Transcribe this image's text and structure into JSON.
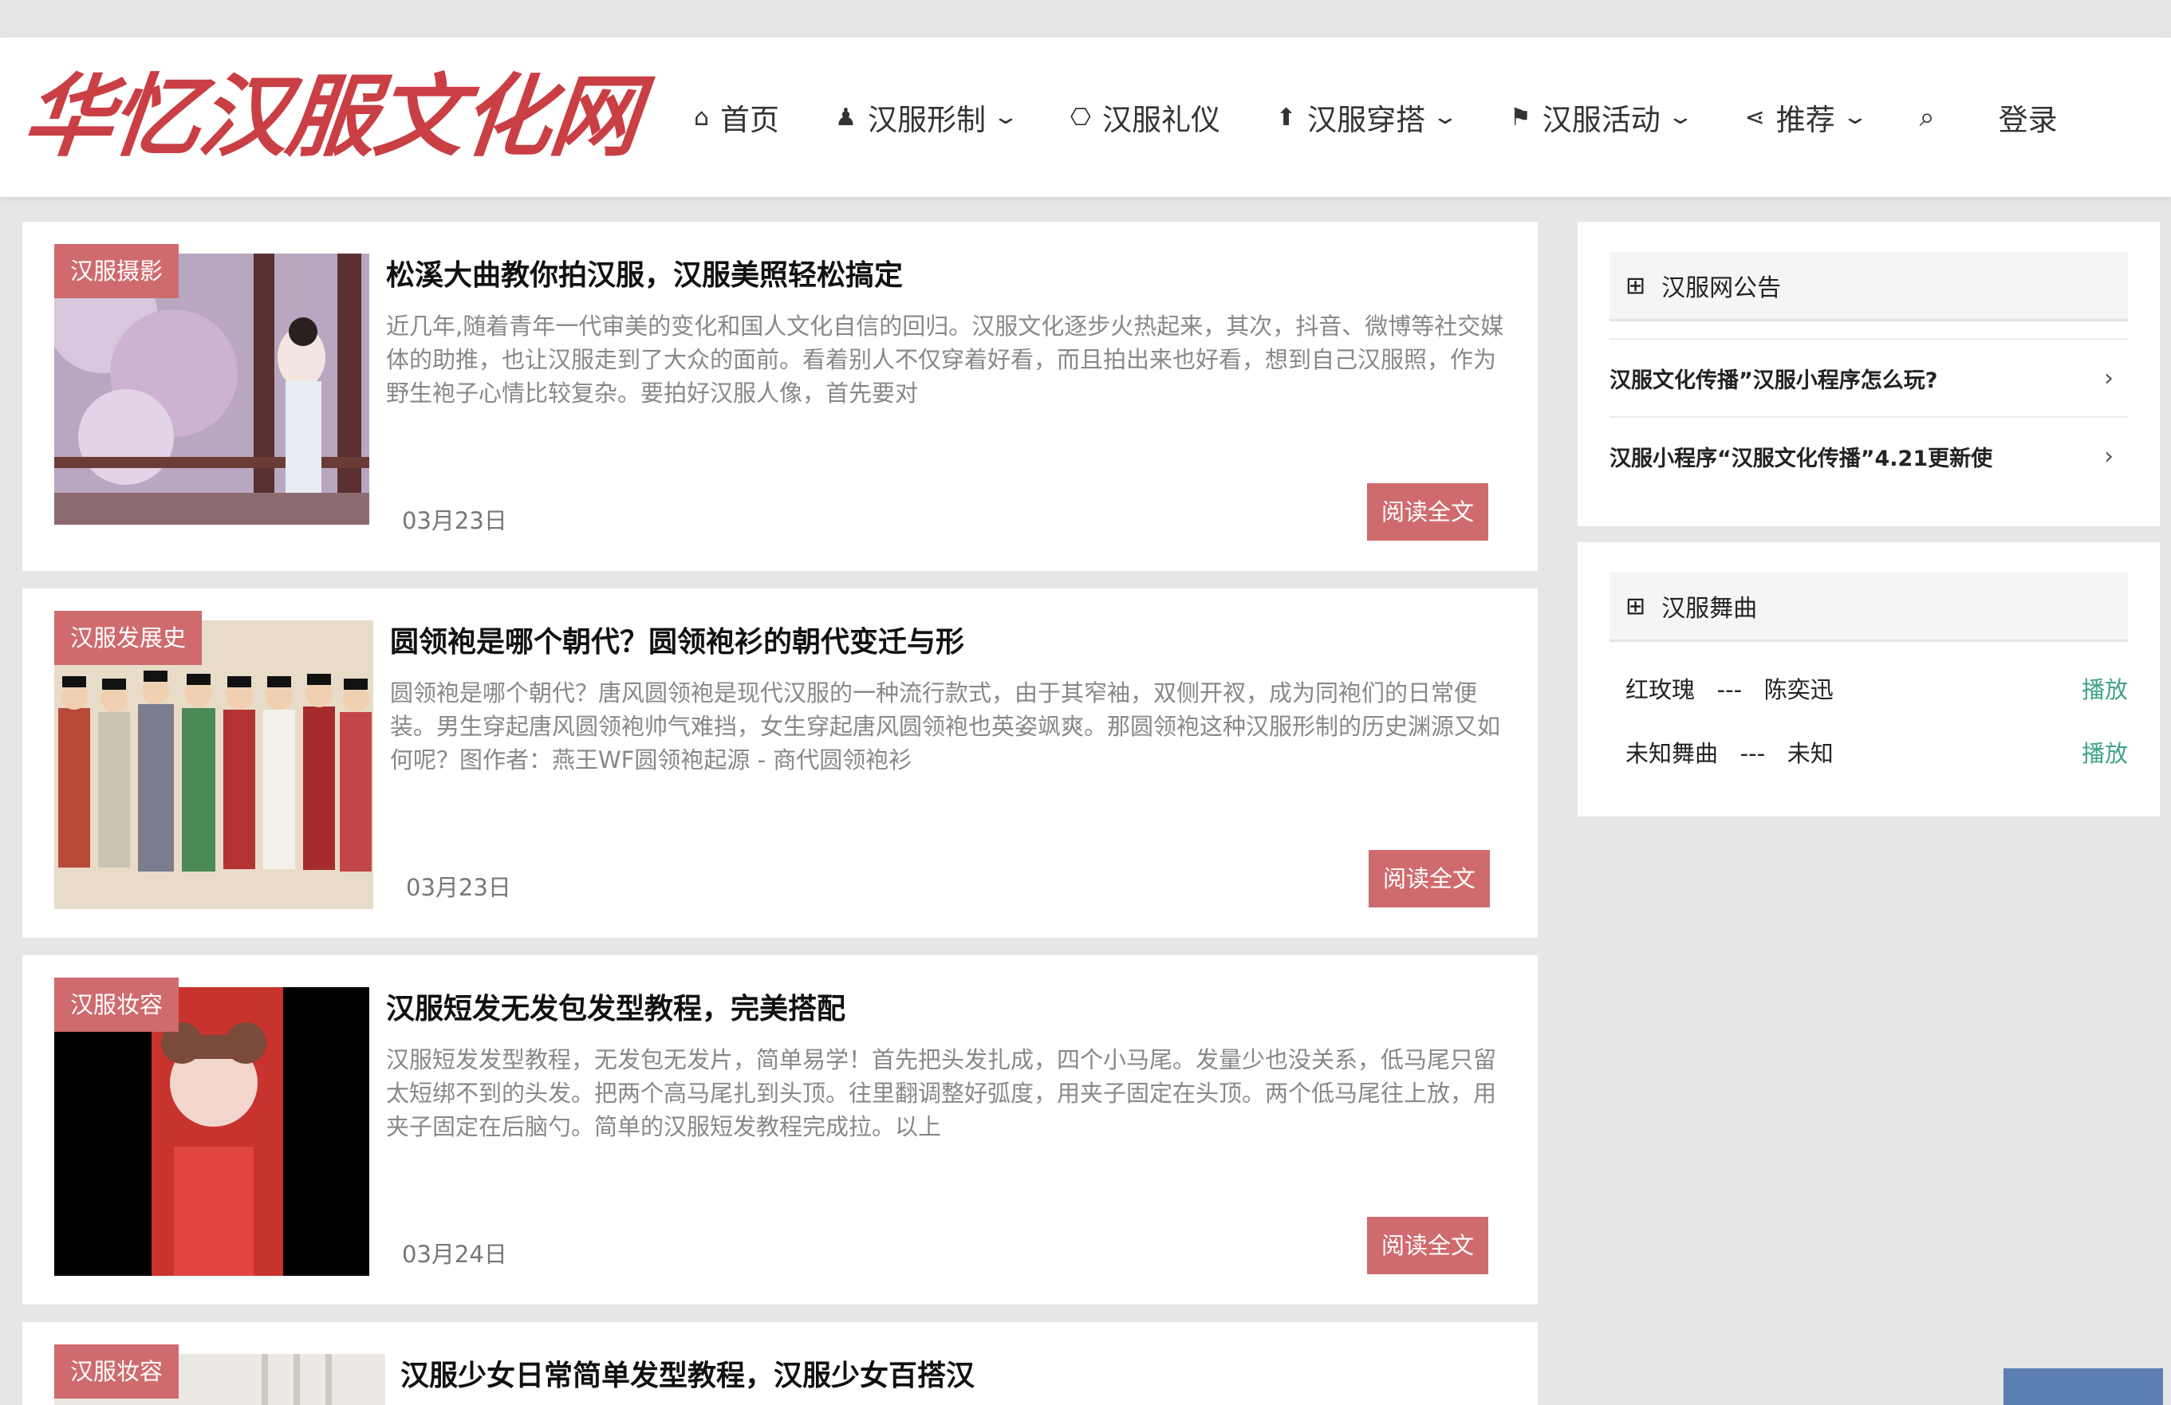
{
  "header": {
    "logo_text": "华忆汉服文化网",
    "nav": [
      {
        "icon": "home-icon",
        "label": "首页",
        "dropdown": false
      },
      {
        "icon": "person-icon",
        "label": "汉服形制",
        "dropdown": true
      },
      {
        "icon": "gift-icon",
        "label": "汉服礼仪",
        "dropdown": false
      },
      {
        "icon": "tshirt-icon",
        "label": "汉服穿搭",
        "dropdown": true
      },
      {
        "icon": "flag-icon",
        "label": "汉服活动",
        "dropdown": true
      },
      {
        "icon": "share-icon",
        "label": "推荐",
        "dropdown": true
      }
    ],
    "login_label": "登录"
  },
  "posts": [
    {
      "tag": "汉服摄影",
      "title": "松溪大曲教你拍汉服，汉服美照轻松搞定",
      "excerpt": "近几年,随着青年一代审美的变化和国人文化自信的回归。汉服文化逐步火热起来，其次，抖音、微博等社交媒体的助推，也让汉服走到了大众的面前。看着别人不仅穿着好看，而且拍出来也好看，想到自己汉服照，作为野生袍子心情比较复杂。要拍好汉服人像，首先要对",
      "date": "03月23日",
      "button": "阅读全文"
    },
    {
      "tag": "汉服发展史",
      "title": "圆领袍是哪个朝代？圆领袍衫的朝代变迁与形",
      "excerpt": "圆领袍是哪个朝代？唐风圆领袍是现代汉服的一种流行款式，由于其窄袖，双侧开衩，成为同袍们的日常便装。男生穿起唐风圆领袍帅气难挡，女生穿起唐风圆领袍也英姿飒爽。那圆领袍这种汉服形制的历史渊源又如何呢？图作者：燕王WF圆领袍起源 - 商代圆领袍衫",
      "date": "03月23日",
      "button": "阅读全文"
    },
    {
      "tag": "汉服妆容",
      "title": "汉服短发无发包发型教程，完美搭配",
      "excerpt": "汉服短发发型教程，无发包无发片，简单易学！首先把头发扎成，四个小马尾。发量少也没关系，低马尾只留太短绑不到的头发。把两个高马尾扎到头顶。往里翻调整好弧度，用夹子固定在头顶。两个低马尾往上放，用夹子固定在后脑勺。简单的汉服短发教程完成拉。以上",
      "date": "03月24日",
      "button": "阅读全文"
    },
    {
      "tag": "汉服妆容",
      "title": "汉服少女日常简单发型教程，汉服少女百搭汉",
      "excerpt": "",
      "date": "",
      "button": ""
    }
  ],
  "sidebar": {
    "notice_title": "汉服网公告",
    "notices": [
      "汉服文化传播”汉服小程序怎么玩?",
      "汉服小程序“汉服文化传播”4.21更新使"
    ],
    "music_title": "汉服舞曲",
    "songs": [
      {
        "name": "红玫瑰",
        "sep": "---",
        "artist": "陈奕迅",
        "action": "播放"
      },
      {
        "name": "未知舞曲",
        "sep": "---",
        "artist": "未知",
        "action": "播放"
      }
    ]
  },
  "colors": {
    "accent": "#cf6b6e",
    "logo": "#c93f44",
    "play": "#3fa38a"
  }
}
